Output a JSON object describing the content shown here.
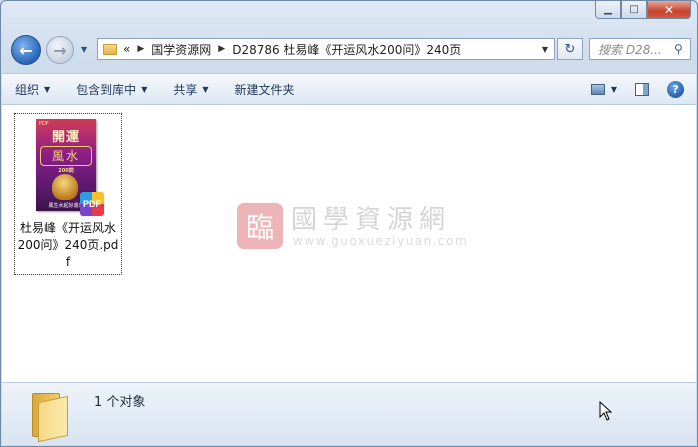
{
  "window": {
    "caption": {
      "minimize": "▁",
      "maximize": "□",
      "close": "✕"
    }
  },
  "nav": {
    "back_icon": "←",
    "forward_icon": "→",
    "address": {
      "overflow": "«",
      "crumbs": [
        "国学资源网",
        "D28786 杜易峰《开运风水200问》240页"
      ]
    },
    "refresh_icon": "↻",
    "search_placeholder": "搜索 D28..."
  },
  "toolbar": {
    "organize": "组织",
    "include_in_library": "包含到库中",
    "share": "共享",
    "new_folder": "新建文件夹"
  },
  "files": [
    {
      "name": "杜易峰《开运风水200问》240页.pdf",
      "badge": "PDF",
      "cover": {
        "tag": "PDF",
        "title": "開運",
        "subtitle": "風水",
        "number": "200問",
        "footer": "風生水起好運來"
      }
    }
  ],
  "watermark": {
    "seal": "臨",
    "title": "國學資源網",
    "url": "www.guoxueziyuan.com"
  },
  "status": {
    "count": "1 个对象"
  }
}
